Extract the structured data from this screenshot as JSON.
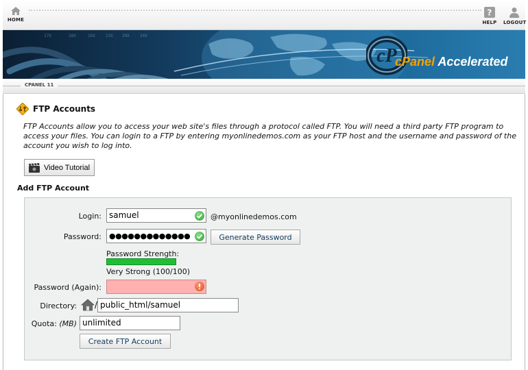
{
  "nav": {
    "home_label": "HOME",
    "help_label": "HELP",
    "logout_label": "LOGOUT"
  },
  "banner": {
    "brand_prefix": "cPanel",
    "brand_suffix": "Accelerated"
  },
  "breadcrumb": {
    "label": "CPANEL 11"
  },
  "page": {
    "title": "FTP Accounts",
    "intro": "FTP Accounts allow you to access your web site's files through a protocol called FTP. You will need a third party FTP program to access your files. You can login to a FTP by entering myonlinedemos.com as your FTP host and the username and password of the account you wish to log into.",
    "video_button": "Video Tutorial",
    "section_title": "Add FTP Account"
  },
  "form": {
    "login_label": "Login:",
    "login_value": "samuel",
    "domain_suffix": "@myonlinedemos.com",
    "password_label": "Password:",
    "password_value": "●●●●●●●●●●●●●",
    "generate_button": "Generate Password",
    "strength_label": "Password Strength:",
    "strength_value": 100,
    "strength_text": "Very Strong (100/100)",
    "password_again_label": "Password (Again):",
    "password_again_value": "",
    "directory_label": "Directory:",
    "directory_value": "public_html/samuel",
    "directory_separator": "/",
    "quota_label": "Quota:",
    "quota_unit": "(MB)",
    "quota_value": "unlimited",
    "create_button": "Create FTP Account"
  },
  "colors": {
    "ok": "#2f9a2f",
    "error": "#d24a1d",
    "error_field": "#ffb0b0",
    "strength": "#1fbf35",
    "brand_orange": "#f5a200"
  }
}
